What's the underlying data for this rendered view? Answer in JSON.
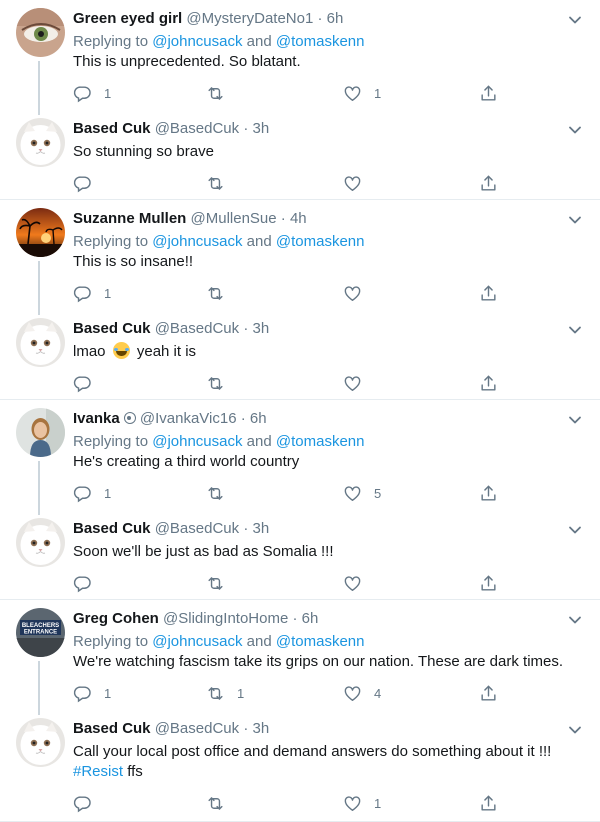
{
  "replying_prefix": "Replying to ",
  "replying_and": " and ",
  "mentions": [
    "@johncusack",
    "@tomaskenn"
  ],
  "tweets": [
    {
      "name": "Green eyed girl",
      "handle": "@MysteryDateNo1",
      "time": "6h",
      "replying": true,
      "text": "This is unprecedented. So blatant.",
      "replies": "1",
      "retweets": "",
      "likes": "1",
      "avatar": "green-eye-photo"
    },
    {
      "name": "Based Cuk",
      "handle": "@BasedCuk",
      "time": "3h",
      "replying": false,
      "text": "So stunning so brave",
      "replies": "",
      "retweets": "",
      "likes": "",
      "avatar": "white-persian-cat-photo"
    },
    {
      "name": "Suzanne Mullen",
      "handle": "@MullenSue",
      "time": "4h",
      "replying": true,
      "text": "This is so insane!!",
      "replies": "1",
      "retweets": "",
      "likes": "",
      "avatar": "sunset-palm-trees-photo"
    },
    {
      "name": "Based Cuk",
      "handle": "@BasedCuk",
      "time": "3h",
      "replying": false,
      "text_before_emoji": "lmao",
      "emoji": "tears-of-joy-emoji",
      "text_after_emoji": "yeah it is",
      "replies": "",
      "retweets": "",
      "likes": "",
      "avatar": "white-persian-cat-photo"
    },
    {
      "name": "Ivanka",
      "handle": "@IvankaVic16",
      "time": "6h",
      "replying": true,
      "text": "He's creating a third world country",
      "replies": "1",
      "retweets": "",
      "likes": "5",
      "avatar": "woman-portrait-photo"
    },
    {
      "name": "Based Cuk",
      "handle": "@BasedCuk",
      "time": "3h",
      "replying": false,
      "text": "Soon we'll be just as bad as Somalia !!!",
      "replies": "",
      "retweets": "",
      "likes": "",
      "avatar": "white-persian-cat-photo"
    },
    {
      "name": "Greg Cohen",
      "handle": "@SlidingIntoHome",
      "time": "6h",
      "replying": true,
      "text": "We're watching fascism take its grips on our nation. These are dark times.",
      "replies": "1",
      "retweets": "1",
      "likes": "4",
      "avatar": "bleachers-entrance-sign-photo",
      "avatar_sign_line1": "BLEACHERS",
      "avatar_sign_line2": "ENTRANCE"
    },
    {
      "name": "Based Cuk",
      "handle": "@BasedCuk",
      "time": "3h",
      "replying": false,
      "text_line1": "Call your local post office and demand answers do something about it !!!",
      "hashtag": "#Resist",
      "text_line2_rest": " ffs",
      "replies": "",
      "retweets": "",
      "likes": "1",
      "avatar": "white-persian-cat-photo"
    }
  ],
  "dot": "·",
  "colors": {
    "link": "#1b95e0",
    "secondary": "#657786",
    "divider": "#e6ecf0",
    "thread_line": "#ccd6dd"
  }
}
